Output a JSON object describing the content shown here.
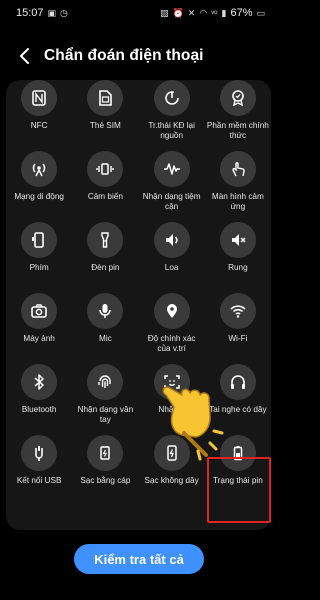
{
  "status_bar": {
    "time": "15:07",
    "battery": "67%",
    "left_icons": [
      "screen-record-icon",
      "clock-icon"
    ],
    "right_icons": [
      "photo-icon",
      "alarm-icon",
      "mute-icon",
      "wifi-icon",
      "volte-icon",
      "signal-icon"
    ]
  },
  "header": {
    "title": "Chẩn đoán điện thoại"
  },
  "tests": [
    {
      "label": "NFC",
      "icon": "nfc-icon"
    },
    {
      "label": "Thẻ SIM",
      "icon": "sim-card-icon"
    },
    {
      "label": "Tr.thái KĐ lại nguồn",
      "icon": "power-reboot-icon"
    },
    {
      "label": "Phần mềm chính thức",
      "icon": "certified-badge-icon"
    },
    {
      "label": "Mạng di động",
      "icon": "cellular-network-icon"
    },
    {
      "label": "Cảm biến",
      "icon": "sensor-vibrate-icon"
    },
    {
      "label": "Nhận dạng tiệm cận",
      "icon": "proximity-wave-icon"
    },
    {
      "label": "Màn hình cảm ứng",
      "icon": "touch-hand-icon"
    },
    {
      "label": "Phím",
      "icon": "phone-button-icon"
    },
    {
      "label": "Đèn pin",
      "icon": "flashlight-icon"
    },
    {
      "label": "Loa",
      "icon": "speaker-icon"
    },
    {
      "label": "Rung",
      "icon": "vibrate-mute-icon"
    },
    {
      "label": "Máy ảnh",
      "icon": "camera-icon"
    },
    {
      "label": "Mic",
      "icon": "microphone-icon"
    },
    {
      "label": "Độ chính xác của v.trí",
      "icon": "location-pin-icon"
    },
    {
      "label": "Wi-Fi",
      "icon": "wifi-test-icon"
    },
    {
      "label": "Bluetooth",
      "icon": "bluetooth-icon"
    },
    {
      "label": "Nhận dạng vân tay",
      "icon": "fingerprint-icon"
    },
    {
      "label": "Nhận d",
      "icon": "face-recognition-icon"
    },
    {
      "label": "Tai nghe có dây",
      "icon": "headphones-icon"
    },
    {
      "label": "Kết nối USB",
      "icon": "usb-connection-icon"
    },
    {
      "label": "Sạc bằng cáp",
      "icon": "cable-charging-icon"
    },
    {
      "label": "Sạc không dây",
      "icon": "wireless-charging-icon"
    },
    {
      "label": "Trạng thái pin",
      "icon": "battery-status-icon"
    }
  ],
  "actions": {
    "test_all_label": "Kiểm tra tất cả"
  },
  "colors": {
    "background": "#000000",
    "panel": "#161616",
    "icon_circle": "#3a3a3a",
    "primary_button": "#3e91ff",
    "highlight": "#e02424",
    "pointer_hand": "#f6c531"
  }
}
